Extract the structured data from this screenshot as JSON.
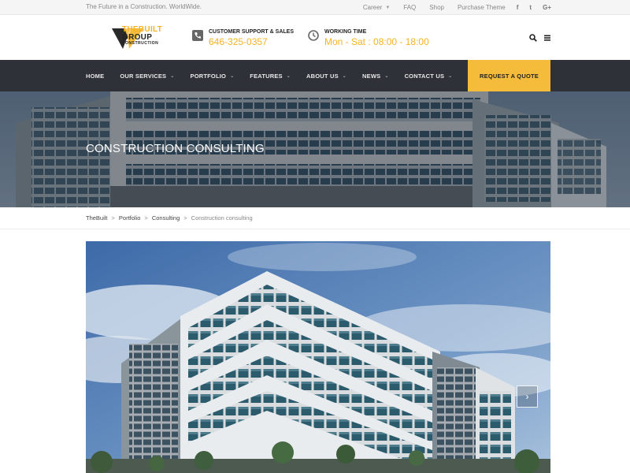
{
  "topbar": {
    "tagline": "The Future in a Construction. WorldWide.",
    "links": [
      {
        "label": "Career",
        "has_dropdown": true
      },
      {
        "label": "FAQ",
        "has_dropdown": false
      },
      {
        "label": "Shop",
        "has_dropdown": false
      },
      {
        "label": "Purchase Theme",
        "has_dropdown": false
      }
    ],
    "social": [
      {
        "icon": "facebook-icon",
        "glyph": "f"
      },
      {
        "icon": "twitter-icon",
        "glyph": "t"
      },
      {
        "icon": "google-plus-icon",
        "glyph": "G+"
      }
    ]
  },
  "header": {
    "logo": {
      "line1": "THEBUILT",
      "line2": "GROUP",
      "line3": "CONSTRUCTION"
    },
    "support": {
      "icon": "phone-icon",
      "title": "CUSTOMER SUPPORT & SALES",
      "value": "646-325-0357"
    },
    "working": {
      "icon": "clock-icon",
      "title": "WORKING TIME",
      "value": "Mon - Sat : 08:00 - 18:00"
    },
    "icons": [
      "search-icon",
      "menu-icon"
    ]
  },
  "nav": {
    "items": [
      {
        "label": "HOME",
        "has_dropdown": false
      },
      {
        "label": "OUR SERVICES",
        "has_dropdown": true
      },
      {
        "label": "PORTFOLIO",
        "has_dropdown": true
      },
      {
        "label": "FEATURES",
        "has_dropdown": true
      },
      {
        "label": "ABOUT US",
        "has_dropdown": true
      },
      {
        "label": "NEWS",
        "has_dropdown": true
      },
      {
        "label": "CONTACT US",
        "has_dropdown": true
      }
    ],
    "cta": "REQUEST A QUOTE"
  },
  "hero": {
    "title": "CONSTRUCTION CONSULTING"
  },
  "breadcrumb": {
    "items": [
      "TheBuilt",
      "Portfolio",
      "Consulting"
    ],
    "current": "Construction consulting",
    "separator": ">"
  },
  "slider": {
    "next_icon": "chevron-right-icon"
  },
  "colors": {
    "accent": "#f5bc3c",
    "nav_bg": "#2e3138",
    "topbar_bg": "#f5f5f5"
  }
}
